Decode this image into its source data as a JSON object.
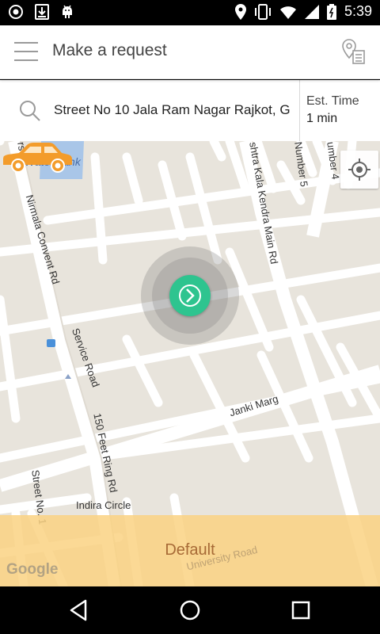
{
  "status_bar": {
    "time": "5:39",
    "left_icons": [
      "record-icon",
      "download-icon",
      "android-icon"
    ],
    "right_icons": [
      "location-pin-icon",
      "vibrate-icon",
      "wifi-icon",
      "signal-icon",
      "battery-icon"
    ]
  },
  "app_bar": {
    "title": "Make a request",
    "menu_icon": "hamburger-menu-icon",
    "action_icon": "map-pin-list-icon"
  },
  "search": {
    "address": "Street No 10 Jala Ram Nagar Rajkot, G",
    "icon": "search-icon",
    "est_label": "Est. Time",
    "est_value": "1 min"
  },
  "map": {
    "labels": {
      "water_tank": "Water Tank",
      "nirmala": "Nirmala Convent Rd",
      "service_road": "Service Road",
      "ring_road": "150 Feet Ring Rd",
      "street_no": "Street No. 1",
      "indira": "Indira Circle",
      "janki": "Janki Marg",
      "rashtra": "shtra Kala Kendra Main Rd",
      "number5": "Number 5",
      "number4": "umber 4",
      "edge_rs": "rs",
      "university": "University Road"
    },
    "locate_icon": "my-location-icon",
    "pickup_icon": "chevron-right-icon",
    "car_icon": "car-icon",
    "car_color": "#f39c2b",
    "pickup_color": "#2ec48f",
    "google": "Google"
  },
  "footer": {
    "default_label": "Default"
  },
  "nav_bar": {
    "icons": [
      "back-icon",
      "home-icon",
      "recents-icon"
    ]
  }
}
